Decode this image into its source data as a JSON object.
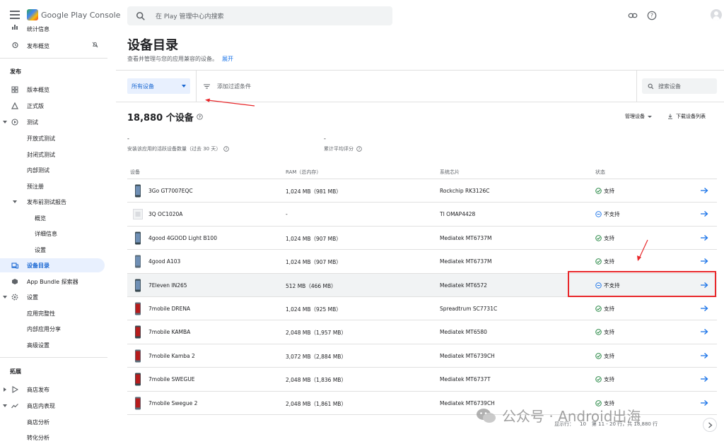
{
  "app": {
    "brand": "Google Play Console",
    "search_placeholder": "在 Play 管理中心内搜索"
  },
  "sidebar": {
    "top_items": [
      {
        "label": "统计信息",
        "icon": "chart-icon"
      },
      {
        "label": "发布概览",
        "icon": "history-icon",
        "trail_icon": "notifications-off-icon"
      }
    ],
    "section_release": "发布",
    "release_items": [
      {
        "label": "版本概览",
        "icon": "dashboard-icon"
      },
      {
        "label": "正式版",
        "icon": "production-icon"
      },
      {
        "label": "测试",
        "icon": "play-circle-icon"
      },
      {
        "label": "开放式测试"
      },
      {
        "label": "封闭式测试"
      },
      {
        "label": "内部测试"
      },
      {
        "label": "预注册"
      },
      {
        "label": "发布前测试报告"
      },
      {
        "label": "概览"
      },
      {
        "label": "详细信息"
      },
      {
        "label": "设置"
      },
      {
        "label": "设备目录",
        "icon": "devices-icon",
        "active": true
      },
      {
        "label": "App Bundle 探索器",
        "icon": "bundle-icon"
      },
      {
        "label": "设置",
        "icon": "settings-icon"
      },
      {
        "label": "应用完整性"
      },
      {
        "label": "内部应用分享"
      },
      {
        "label": "高级设置"
      }
    ],
    "section_grow": "拓展",
    "grow_items": [
      {
        "label": "商店发布",
        "icon": "play-store-icon"
      },
      {
        "label": "商店内表现",
        "icon": "trending-icon"
      },
      {
        "label": "商店分析"
      },
      {
        "label": "转化分析"
      }
    ]
  },
  "page": {
    "title": "设备目录",
    "subtitle": "查看并管理与您的应用兼容的设备。",
    "expand_link": "展开"
  },
  "filters": {
    "device_select": "所有设备",
    "add_filter": "添加过滤条件",
    "search_placeholder": "搜索设备"
  },
  "summary": {
    "count": "18,880 个设备",
    "manage_devices": "管理设备",
    "download_list": "下载设备列表",
    "stat1_value": "-",
    "stat1_label": "安装该应用的活跃设备数量（过去 30 天）",
    "stat2_value": "-",
    "stat2_label": "累计平均评分"
  },
  "table": {
    "headers": {
      "device": "设备",
      "ram": "RAM（总内存）",
      "soc": "系统芯片",
      "status": "状态"
    },
    "rows": [
      {
        "device": "3Go GT7007EQC",
        "ram": "1,024 MB（981 MB）",
        "soc": "Rockchip RK3126C",
        "status": "支持",
        "supported": true
      },
      {
        "device": "3Q OC1020A",
        "ram": "-",
        "soc": "TI OMAP4428",
        "status": "不支持",
        "supported": false
      },
      {
        "device": "4good 4GOOD Light B100",
        "ram": "1,024 MB（907 MB）",
        "soc": "Mediatek MT6737M",
        "status": "支持",
        "supported": true
      },
      {
        "device": "4good A103",
        "ram": "1,024 MB（907 MB）",
        "soc": "Mediatek MT6737M",
        "status": "支持",
        "supported": true
      },
      {
        "device": "7Eleven IN265",
        "ram": "512 MB（466 MB）",
        "soc": "Mediatek MT6572",
        "status": "不支持",
        "supported": false,
        "highlighted": true
      },
      {
        "device": "7mobile DRENA",
        "ram": "1,024 MB（925 MB）",
        "soc": "Spreadtrum SC7731C",
        "status": "支持",
        "supported": true
      },
      {
        "device": "7mobile KAMBA",
        "ram": "2,048 MB（1,957 MB）",
        "soc": "Mediatek MT6580",
        "status": "支持",
        "supported": true
      },
      {
        "device": "7mobile Kamba 2",
        "ram": "3,072 MB（2,884 MB）",
        "soc": "Mediatek MT6739CH",
        "status": "支持",
        "supported": true
      },
      {
        "device": "7mobile SWEGUE",
        "ram": "2,048 MB（1,836 MB）",
        "soc": "Mediatek MT6737T",
        "status": "支持",
        "supported": true
      },
      {
        "device": "7mobile Swegue 2",
        "ram": "2,048 MB（1,861 MB）",
        "soc": "Mediatek MT6739CH",
        "status": "支持",
        "supported": true
      }
    ]
  },
  "pagination": {
    "rows_per_page_label": "显示行：",
    "rows_per_page": "10",
    "range": "第 11 - 20 行，共 18,880 行"
  },
  "watermark": "公众号 · Android出海",
  "colors": {
    "accent": "#1a73e8",
    "supported": "#188038",
    "unsupported": "#1a73e8",
    "annotation_red": "#e8272a"
  }
}
